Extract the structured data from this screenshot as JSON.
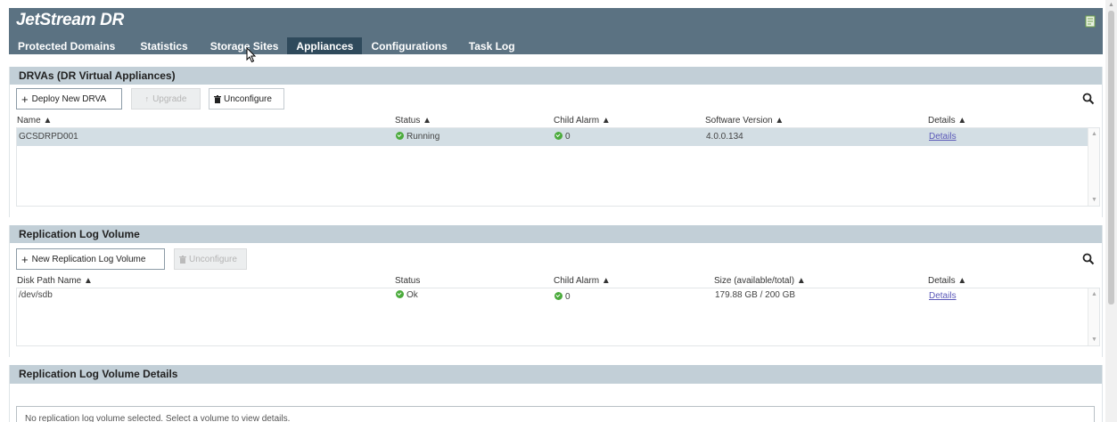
{
  "app": {
    "title": "JetStream DR",
    "nav": [
      {
        "label": "Protected Domains",
        "active": false
      },
      {
        "label": "Statistics",
        "active": false
      },
      {
        "label": "Storage Sites",
        "active": false
      },
      {
        "label": "Appliances",
        "active": true
      },
      {
        "label": "Configurations",
        "active": false
      },
      {
        "label": "Task Log",
        "active": false
      }
    ],
    "header_icon": "report-icon"
  },
  "drva": {
    "title": "DRVAs (DR Virtual Appliances)",
    "buttons": {
      "deploy": "Deploy New DRVA",
      "upgrade": "Upgrade",
      "unconfigure": "Unconfigure"
    },
    "columns": [
      "Name ▲",
      "Status ▲",
      "Child Alarm ▲",
      "Software Version ▲",
      "Details ▲"
    ],
    "rows": [
      {
        "name": "GCSDRPD001",
        "status": "Running",
        "child_alarm": "0",
        "software_version": "4.0.0.134",
        "details": "Details"
      }
    ]
  },
  "replication": {
    "title": "Replication Log Volume",
    "buttons": {
      "new": "New Replication Log Volume",
      "unconfigure": "Unconfigure"
    },
    "columns": [
      "Disk Path Name ▲",
      "Status",
      "Child Alarm ▲",
      "Size (available/total) ▲",
      "Details ▲"
    ],
    "rows": [
      {
        "disk_path": "/dev/sdb",
        "status": "Ok",
        "child_alarm": "0",
        "size": "179.88 GB / 200 GB",
        "details": "Details"
      }
    ]
  },
  "replication_details": {
    "title": "Replication Log Volume Details",
    "message": "No replication log volume selected. Select a volume to view details."
  },
  "colors": {
    "header_bg": "#5b7282",
    "active_tab": "#2f4a5c",
    "panel_title_bg": "#c2cfd7",
    "status_ok": "#4bab3c",
    "link": "#5a58b8"
  }
}
